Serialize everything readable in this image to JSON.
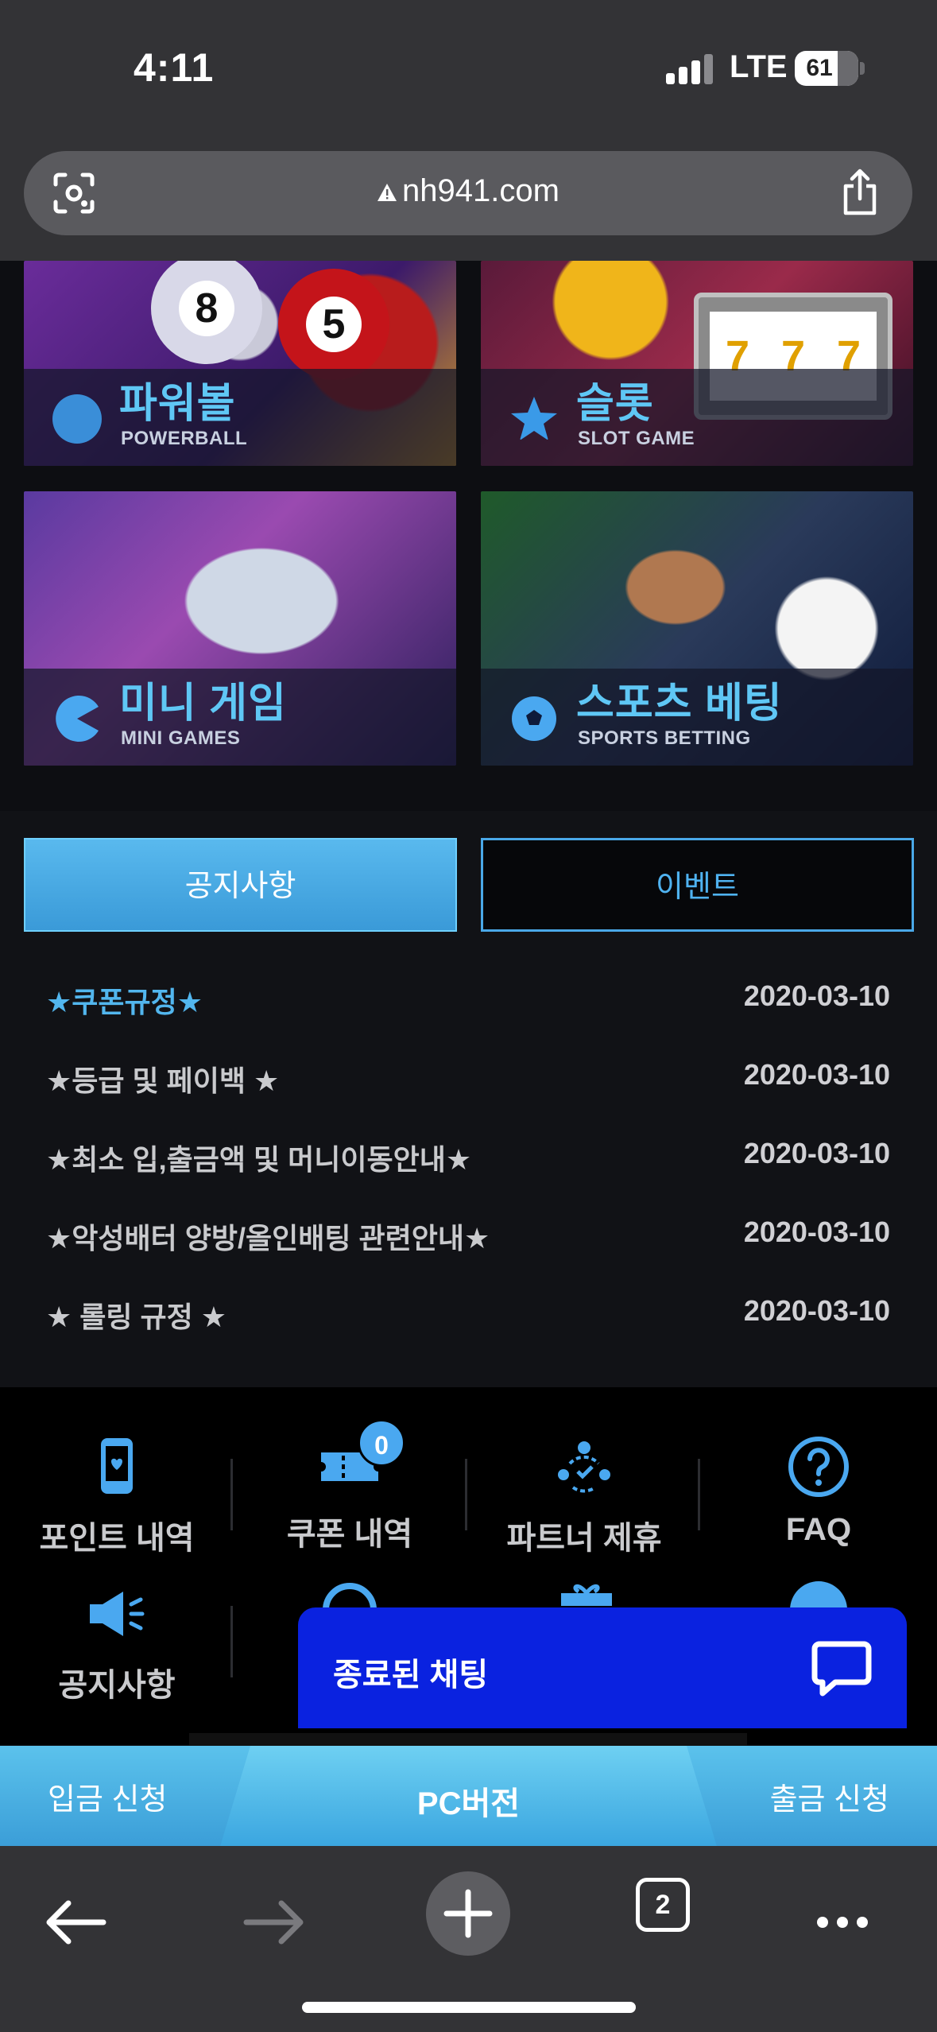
{
  "status": {
    "time": "4:11",
    "network": "LTE",
    "battery": "61"
  },
  "browser": {
    "url": "nh941.com",
    "tab_count": "2"
  },
  "games": [
    {
      "name": "파워볼",
      "sub": "POWERBALL"
    },
    {
      "name": "슬롯",
      "sub": "SLOT GAME"
    },
    {
      "name": "미니 게임",
      "sub": "MINI GAMES"
    },
    {
      "name": "스포츠 베팅",
      "sub": "SPORTS BETTING"
    }
  ],
  "tabs": {
    "notice": "공지사항",
    "event": "이벤트"
  },
  "notices": [
    {
      "title": "★쿠폰규정★",
      "date": "2020-03-10"
    },
    {
      "title": "★등급 및 페이백 ★",
      "date": "2020-03-10"
    },
    {
      "title": "★최소 입,출금액 및 머니이동안내★",
      "date": "2020-03-10"
    },
    {
      "title": "★악성배터 양방/올인배팅 관련안내★",
      "date": "2020-03-10"
    },
    {
      "title": "★ 롤링 규정 ★",
      "date": "2020-03-10"
    }
  ],
  "quick_menu": [
    {
      "label": "포인트 내역",
      "icon": "phone-heart-icon"
    },
    {
      "label": "쿠폰 내역",
      "icon": "ticket-icon",
      "badge": "0"
    },
    {
      "label": "파트너 제휴",
      "icon": "partner-icon"
    },
    {
      "label": "FAQ",
      "icon": "question-icon"
    },
    {
      "label": "공지사항",
      "icon": "megaphone-icon"
    }
  ],
  "chat": {
    "label": "종료된 채팅"
  },
  "bottom_bar": {
    "deposit": "입금 신청",
    "pc": "PC버전",
    "withdraw": "출금 신청"
  },
  "colors": {
    "accent": "#4aa8e8",
    "chat": "#0a22e0"
  }
}
